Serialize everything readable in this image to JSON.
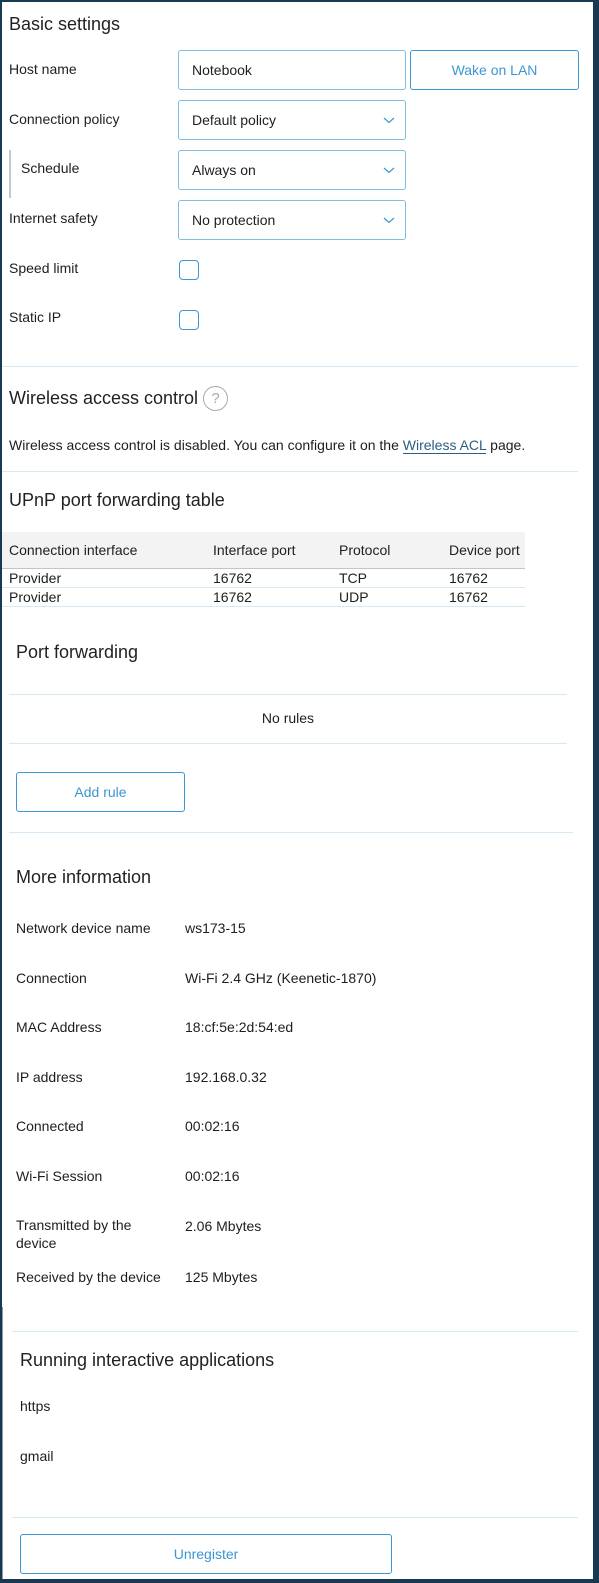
{
  "basic_settings": {
    "title": "Basic settings",
    "host_name": {
      "label": "Host name",
      "value": "Notebook"
    },
    "wake_on_lan_label": "Wake on LAN",
    "connection_policy": {
      "label": "Connection policy",
      "value": "Default policy"
    },
    "schedule": {
      "label": "Schedule",
      "value": "Always on"
    },
    "internet_safety": {
      "label": "Internet safety",
      "value": "No protection"
    },
    "speed_limit": {
      "label": "Speed limit",
      "checked": false
    },
    "static_ip": {
      "label": "Static IP",
      "checked": false
    }
  },
  "wireless_access_control": {
    "title": "Wireless access control",
    "help_icon": "question-circle-icon",
    "help_glyph": "?",
    "text_before": "Wireless access control is disabled. You can configure it on the ",
    "link_text": "Wireless ACL",
    "text_after": " page."
  },
  "upnp": {
    "title": "UPnP port forwarding table",
    "columns": [
      "Connection interface",
      "Interface port",
      "Protocol",
      "Device port"
    ],
    "rows": [
      [
        "Provider",
        "16762",
        "TCP",
        "16762"
      ],
      [
        "Provider",
        "16762",
        "UDP",
        "16762"
      ]
    ]
  },
  "port_forwarding": {
    "title": "Port forwarding",
    "empty_text": "No rules",
    "add_rule_label": "Add rule"
  },
  "more_information": {
    "title": "More information",
    "rows": [
      {
        "label": "Network device name",
        "value": "ws173-15"
      },
      {
        "label": "Connection",
        "value": "Wi-Fi 2.4 GHz (Keenetic-1870)"
      },
      {
        "label": "MAC Address",
        "value": "18:cf:5e:2d:54:ed"
      },
      {
        "label": "IP address",
        "value": "192.168.0.32"
      },
      {
        "label": "Connected",
        "value": "00:02:16"
      },
      {
        "label": "Wi-Fi Session",
        "value": "00:02:16"
      },
      {
        "label": "Transmitted by the device",
        "value": "2.06 Mbytes"
      },
      {
        "label": "Received by the device",
        "value": "125 Mbytes"
      }
    ]
  },
  "running_apps": {
    "title": "Running interactive applications",
    "items": [
      "https",
      "gmail"
    ]
  },
  "unregister_label": "Unregister",
  "colors": {
    "accent": "#3a97d4",
    "field_border": "#7fbde3",
    "divider": "#d6e9f3",
    "frame": "#173a52",
    "link": "#2d5f80"
  }
}
